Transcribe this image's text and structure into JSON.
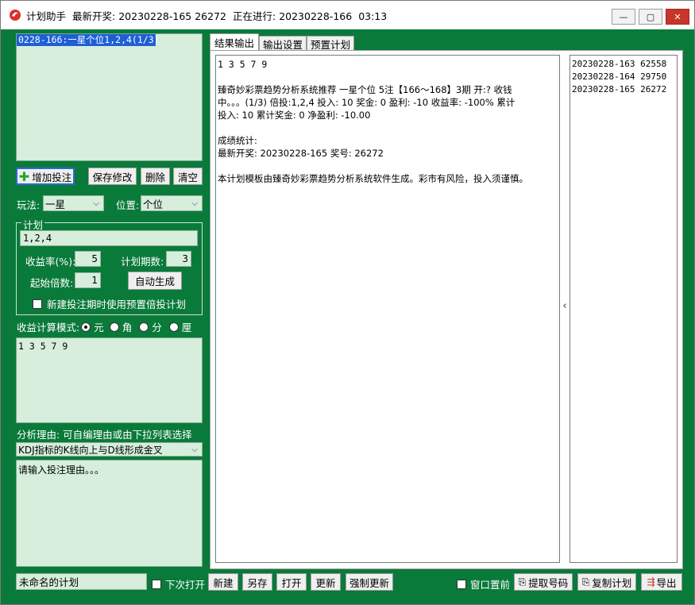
{
  "titlebar": {
    "app_name": "计划助手",
    "latest_draw_label": "最新开奖:",
    "latest_draw_value": "20230228-165 26272",
    "in_progress_label": "正在进行:",
    "in_progress_value": "20230228-166",
    "countdown": "03:13",
    "minimize": "—",
    "maximize": "▢",
    "close": "✕"
  },
  "plan_list": {
    "items": [
      "0228-166:一星个位1,2,4(1/3)"
    ]
  },
  "actions": {
    "add_bet": "增加投注",
    "save_edit": "保存修改",
    "delete": "删除",
    "clear": "清空"
  },
  "play": {
    "label": "玩法:",
    "value": "一星",
    "position_label": "位置:",
    "position_value": "个位"
  },
  "plan_group": {
    "title": "计划",
    "numbers": "1,2,4",
    "yield_label": "收益率(%):",
    "yield_value": "5",
    "periods_label": "计划期数:",
    "periods_value": "3",
    "start_multiple_label": "起始倍数:",
    "start_multiple_value": "1",
    "auto_generate": "自动生成",
    "use_preset_label": "新建投注期时使用预置倍投计划"
  },
  "calc_mode": {
    "label": "收益计算模式:",
    "options": [
      "元",
      "角",
      "分",
      "厘"
    ],
    "selected": "元"
  },
  "numbers_area": {
    "text": "1 3 5 7 9"
  },
  "reason": {
    "label": "分析理由: 可自编理由或由下拉列表选择",
    "dropdown_value": "KDJ指标的K线向上与D线形成金叉",
    "text": "请输入投注理由。。。"
  },
  "tabs": [
    "结果输出",
    "输出设置",
    "预置计划"
  ],
  "output": {
    "line1": "1 3 5 7 9",
    "line2": "臻奇妙彩票趋势分析系统推荐 一星个位 5注【166～168】3期 开:? 收钱",
    "line3": "中。。。(1/3) 倍投:1,2,4 投入: 10 奖金: 0 盈利: -10 收益率: -100% 累计",
    "line4": "投入: 10 累计奖金: 0 净盈利: -10.00",
    "line5": "成绩统计:",
    "line6": "最新开奖: 20230228-165 奖号: 26272",
    "line7": "本计划模板由臻奇妙彩票趋势分析系统软件生成。彩市有风险，投入须谨慎。"
  },
  "history": [
    "20230228-163 62558",
    "20230228-164 29750",
    "20230228-165 26272"
  ],
  "collapse_glyph": "‹",
  "bottom": {
    "plan_name": "未命名的计划",
    "open_next_label": "下次打开",
    "new": "新建",
    "save_as": "另存",
    "open": "打开",
    "update": "更新",
    "force_update": "强制更新",
    "topmost_label": "窗口置前",
    "fetch_numbers": "提取号码",
    "copy_plan": "复制计划",
    "export": "导出"
  },
  "colors": {
    "window_bg": "#0a7a3a",
    "panel_bg": "#d6eedb",
    "close_red": "#c7352b"
  }
}
